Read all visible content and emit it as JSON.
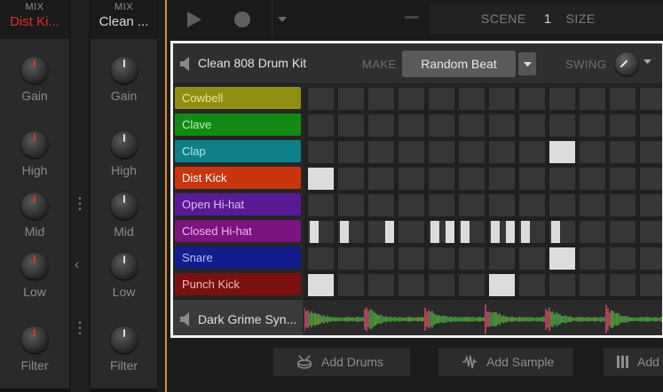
{
  "mixer": {
    "strips": [
      {
        "mix_label": "MIX",
        "name": "Dist Ki..."
      },
      {
        "mix_label": "MIX",
        "name": "Clean ..."
      }
    ],
    "knob_labels": [
      "Gain",
      "High",
      "Mid",
      "Low",
      "Filter"
    ]
  },
  "transport": {
    "scene_label": "SCENE",
    "scene_number": "1",
    "size_label": "SIZE"
  },
  "drum_panel": {
    "title": "Clean 808 Drum Kit",
    "make_label": "MAKE",
    "random_beat_label": "Random Beat",
    "swing_label": "SWING",
    "rows": [
      {
        "name": "Cowbell",
        "color": "#8f8f14",
        "text_color": "#e8e6a0",
        "steps": []
      },
      {
        "name": "Clave",
        "color": "#138a17",
        "text_color": "#b8f0b0",
        "steps": []
      },
      {
        "name": "Clap",
        "color": "#0f7f88",
        "text_color": "#a8e8ee",
        "steps": [
          8
        ]
      },
      {
        "name": "Dist Kick",
        "color": "#c8350e",
        "text_color": "#ffffff",
        "steps": [
          0
        ]
      },
      {
        "name": "Open Hi-hat",
        "color": "#5a1a96",
        "text_color": "#d8c0f4",
        "steps": []
      },
      {
        "name": "Closed Hi-hat",
        "color": "#7a1480",
        "text_color": "#f0b8f0",
        "short_steps": [
          0,
          1,
          2.5,
          4,
          4.5,
          5,
          6,
          6.5,
          7,
          8
        ]
      },
      {
        "name": "Snare",
        "color": "#141c8e",
        "text_color": "#b8c0f0",
        "steps": [
          8
        ]
      },
      {
        "name": "Punch Kick",
        "color": "#7a1010",
        "text_color": "#f0b8b8",
        "steps": [
          0,
          6
        ]
      }
    ],
    "synth_name": "Dark Grime Syn..."
  },
  "bottom_bar": {
    "add_drums": "Add Drums",
    "add_sample": "Add Sample",
    "add_more": "Add"
  }
}
